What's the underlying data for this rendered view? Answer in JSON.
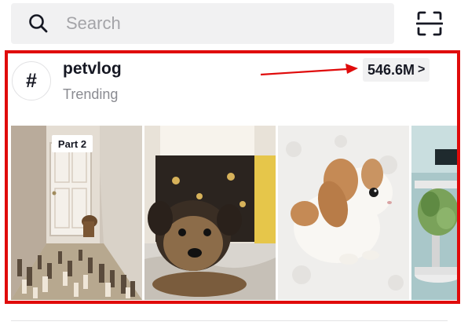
{
  "search": {
    "placeholder": "Search"
  },
  "icons": {
    "search": "search-icon",
    "scan": "scan-icon",
    "hashtag": "hashtag-icon",
    "chevron": "chevron-right-icon"
  },
  "hashtag": {
    "symbol": "#",
    "name": "petvlog",
    "subtitle": "Trending",
    "views": "546.6M",
    "chevron": ">"
  },
  "thumbnails": [
    {
      "overlay_text": "Part 2"
    },
    {
      "overlay_text": ""
    },
    {
      "overlay_text": ""
    },
    {
      "overlay_text": ""
    }
  ],
  "colors": {
    "highlight": "#e00b0b",
    "text_primary": "#161823",
    "text_secondary": "#8a8b91",
    "search_bg": "#f1f1f2"
  }
}
